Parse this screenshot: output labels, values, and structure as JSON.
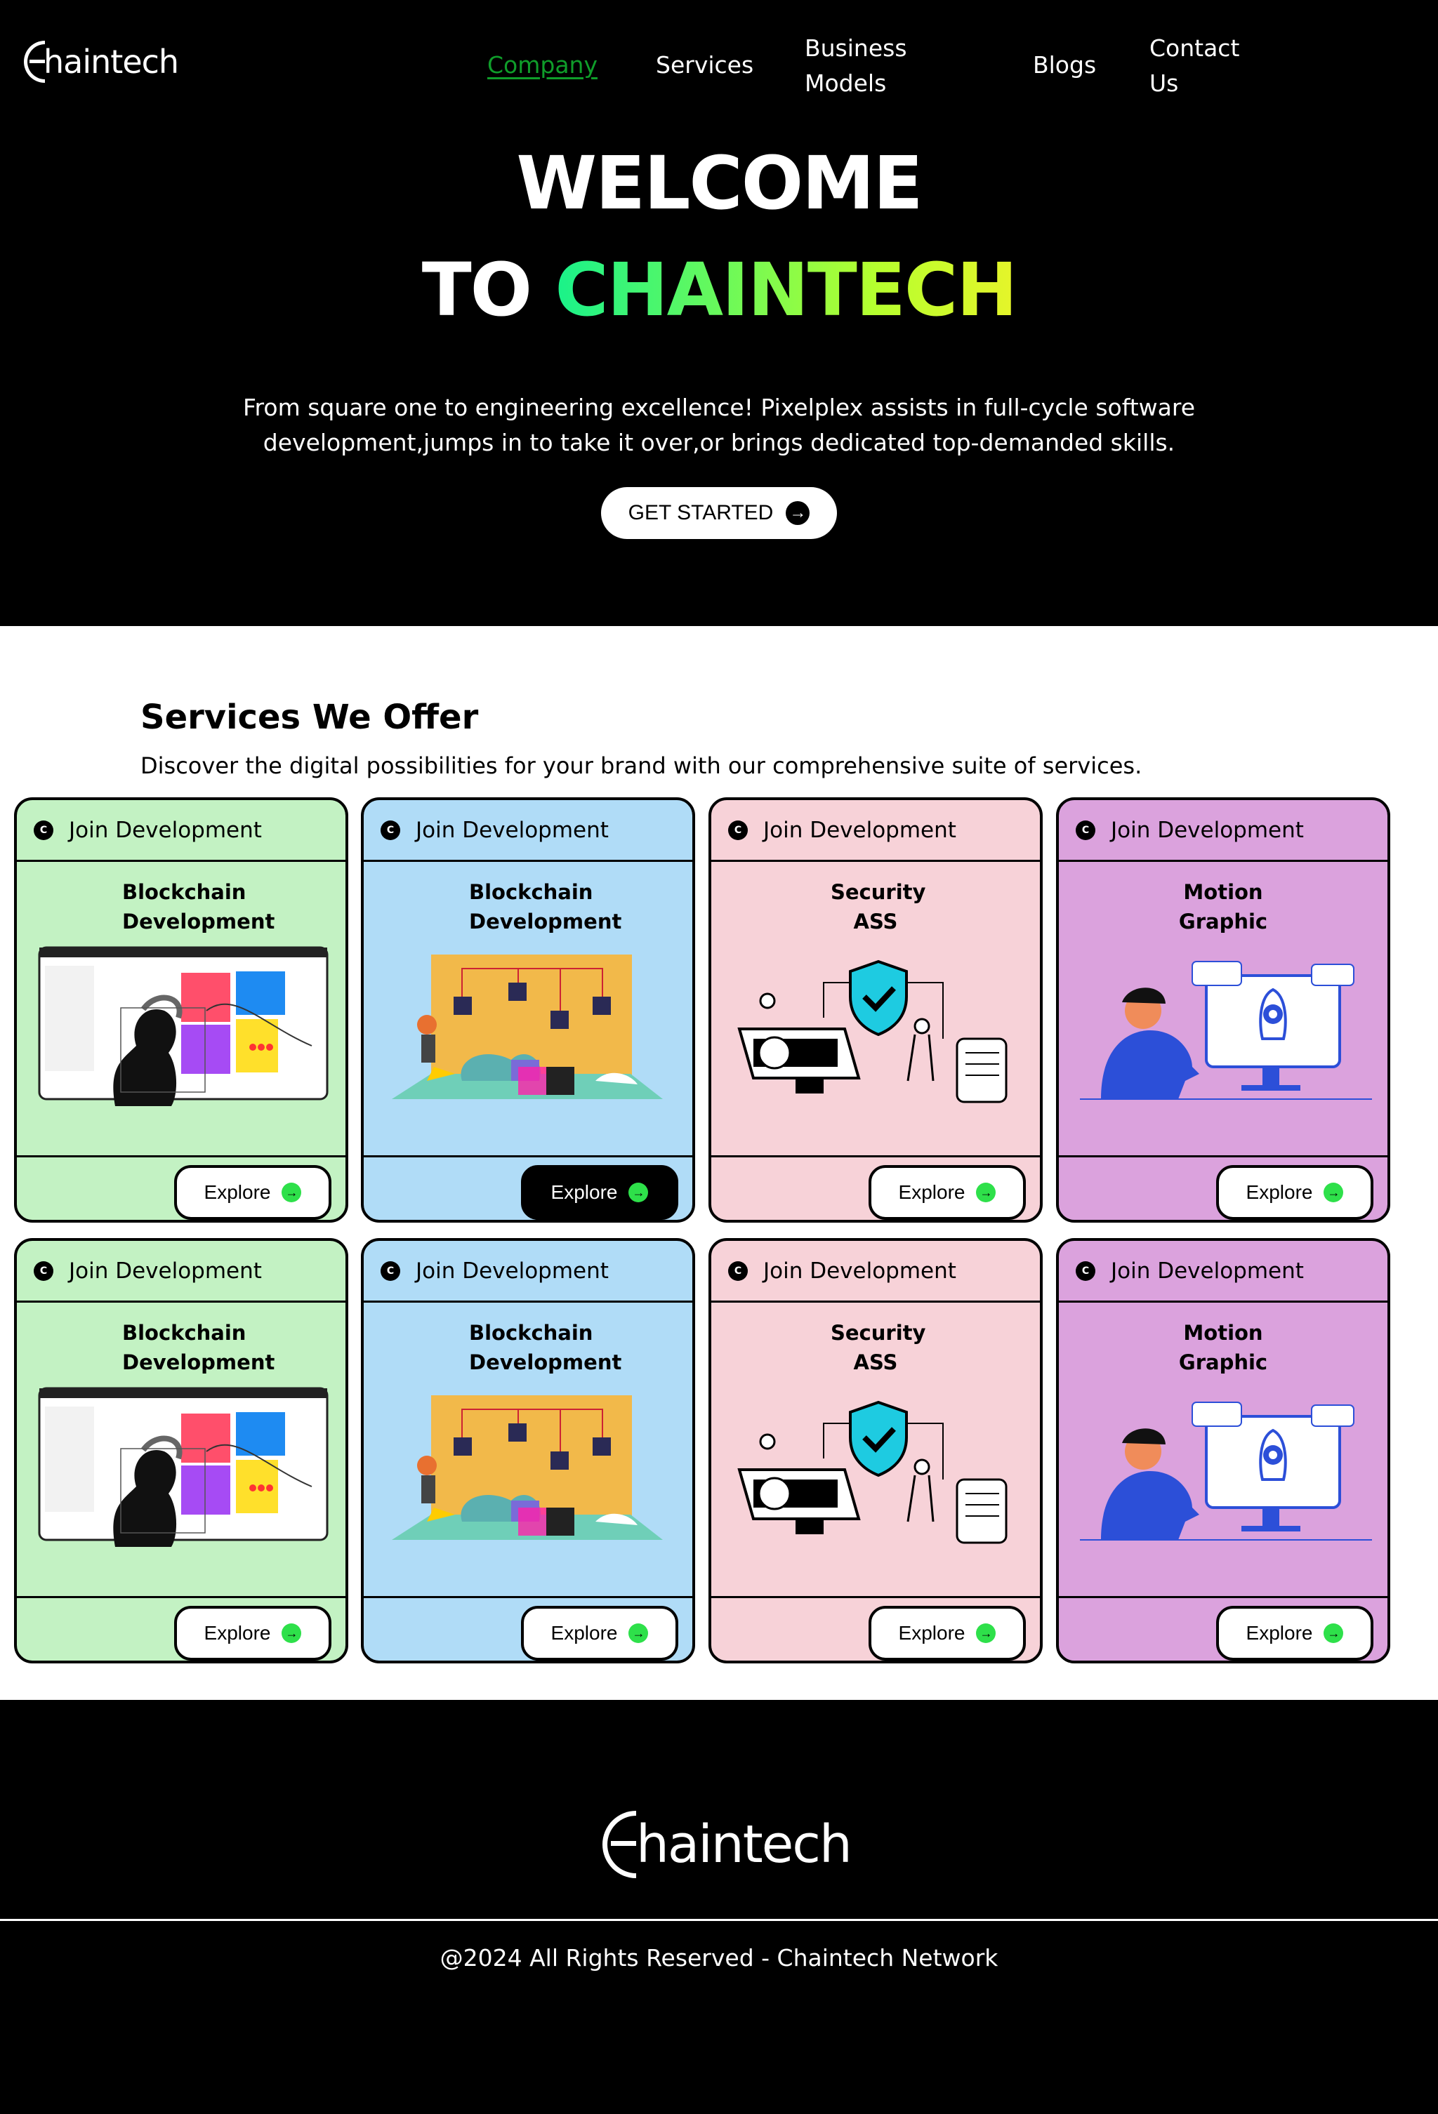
{
  "brand": {
    "logo_text": "haintech"
  },
  "nav": {
    "items": [
      {
        "label": "Company",
        "active": true
      },
      {
        "label": "Services"
      },
      {
        "label": "Business Models"
      },
      {
        "label": "Blogs"
      },
      {
        "label": "Contact Us"
      }
    ]
  },
  "hero": {
    "title_line1": "WELCOME",
    "title_line2_prefix": "TO",
    "title_line2_brand": "CHAINTECH",
    "description": "From square one to engineering excellence! Pixelplex assists in full-cycle software development,jumps in to take it over,or brings dedicated top-demanded skills.",
    "cta_label": "GET STARTED"
  },
  "services": {
    "title": "Services We Offer",
    "subtitle": "Discover the digital possibilities for your brand with our comprehensive suite of services.",
    "cards": [
      {
        "header": "Join Development",
        "title": "Blockchain Development",
        "explore": "Explore",
        "theme": "green",
        "art": "design-ui-illustration"
      },
      {
        "header": "Join Development",
        "title": "Blockchain Development",
        "explore": "Explore",
        "theme": "blue",
        "art": "blockchain-network-illustration",
        "hover": true
      },
      {
        "header": "Join Development",
        "title": "Security ASS",
        "explore": "Explore",
        "theme": "pink",
        "art": "security-shield-illustration"
      },
      {
        "header": "Join Development",
        "title": "Motion Graphic",
        "explore": "Explore",
        "theme": "purple",
        "art": "rocket-monitor-illustration"
      },
      {
        "header": "Join Development",
        "title": "Blockchain Development",
        "explore": "Explore",
        "theme": "green",
        "art": "design-ui-illustration"
      },
      {
        "header": "Join Development",
        "title": "Blockchain Development",
        "explore": "Explore",
        "theme": "blue",
        "art": "blockchain-network-illustration"
      },
      {
        "header": "Join Development",
        "title": "Security ASS",
        "explore": "Explore",
        "theme": "pink",
        "art": "security-shield-illustration"
      },
      {
        "header": "Join Development",
        "title": "Motion Graphic",
        "explore": "Explore",
        "theme": "purple",
        "art": "rocket-monitor-illustration"
      }
    ]
  },
  "footer": {
    "logo_text": "haintech",
    "copyright": "@2024 All Rights Reserved - Chaintech Network"
  },
  "colors": {
    "nav_active": "#0f9d2a",
    "green_card": "#c3f2c3",
    "blue_card": "#b0dcf7",
    "pink_card": "#f7d2d8",
    "purple_card": "#dba2dd",
    "explore_icon": "#2ee04a"
  }
}
